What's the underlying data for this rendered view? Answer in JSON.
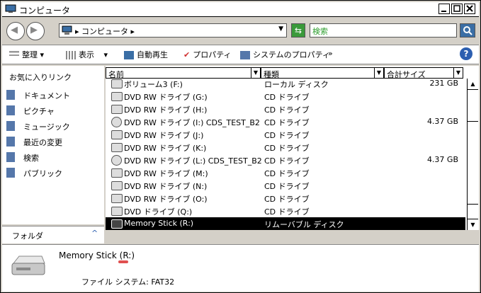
{
  "window": {
    "title": "コンピュータ"
  },
  "address": {
    "crumb_prefix": "▸",
    "crumb": "コンピュータ",
    "crumb_arrow": "▸",
    "dropdown_glyph": "▼"
  },
  "search": {
    "placeholder": "検索"
  },
  "toolbar": {
    "organize": "整理",
    "view": "表示",
    "autoplay": "自動再生",
    "properties": "プロパティ",
    "system_properties": "システムのプロパティ",
    "more": "»",
    "help": "?"
  },
  "nav": {
    "favorites_header": "お気に入りリンク",
    "items": [
      {
        "label": "ドキュメント",
        "icon": "documents-icon"
      },
      {
        "label": "ピクチャ",
        "icon": "pictures-icon"
      },
      {
        "label": "ミュージック",
        "icon": "music-icon"
      },
      {
        "label": "最近の変更",
        "icon": "recent-icon"
      },
      {
        "label": "検索",
        "icon": "search-folder-icon"
      },
      {
        "label": "パブリック",
        "icon": "public-icon"
      }
    ],
    "folders_label": "フォルダ",
    "folders_caret": "^"
  },
  "columns": {
    "name": "名前",
    "type": "種類",
    "size": "合計サイズ"
  },
  "rows": [
    {
      "name": "ボリューム3 (F:)",
      "type": "ローカル ディスク",
      "size": "231 GB",
      "kind": "hdd"
    },
    {
      "name": "DVD RW ドライブ (G:)",
      "type": "CD ドライブ",
      "size": "",
      "kind": "dvd"
    },
    {
      "name": "DVD RW ドライブ (H:)",
      "type": "CD ドライブ",
      "size": "",
      "kind": "dvd"
    },
    {
      "name": "DVD RW ドライブ (I:) CDS_TEST_B2",
      "type": "CD ドライブ",
      "size": "4.37 GB",
      "kind": "cd"
    },
    {
      "name": "DVD RW ドライブ (J:)",
      "type": "CD ドライブ",
      "size": "",
      "kind": "dvd"
    },
    {
      "name": "DVD RW ドライブ (K:)",
      "type": "CD ドライブ",
      "size": "",
      "kind": "dvd"
    },
    {
      "name": "DVD RW ドライブ (L:) CDS_TEST_B2",
      "type": "CD ドライブ",
      "size": "4.37 GB",
      "kind": "cd"
    },
    {
      "name": "DVD RW ドライブ (M:)",
      "type": "CD ドライブ",
      "size": "",
      "kind": "dvd"
    },
    {
      "name": "DVD RW ドライブ (N:)",
      "type": "CD ドライブ",
      "size": "",
      "kind": "dvd"
    },
    {
      "name": "DVD RW ドライブ (O:)",
      "type": "CD ドライブ",
      "size": "",
      "kind": "dvd"
    },
    {
      "name": "DVD ドライブ (Q:)",
      "type": "CD ドライブ",
      "size": "",
      "kind": "dvd"
    },
    {
      "name": "Memory Stick (R:)",
      "type": "リムーバブル ディスク",
      "size": "",
      "kind": "removable",
      "selected": true
    }
  ],
  "details": {
    "name": "Memory Stick (R:)",
    "filesystem_label": "ファイル システム:",
    "filesystem_value": "FAT32"
  },
  "colors": {
    "selection": "#000000",
    "search_text": "#2e9e2e",
    "help": "#2c5fb0"
  }
}
